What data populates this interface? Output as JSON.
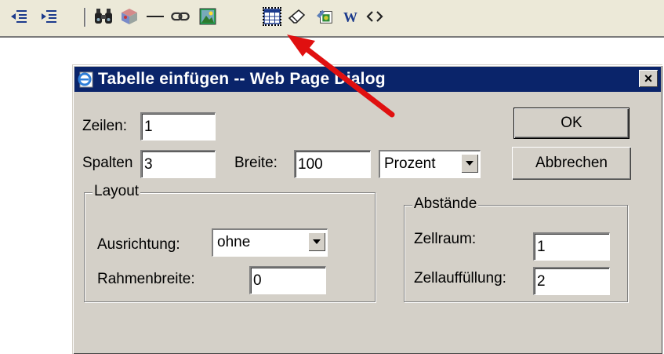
{
  "toolbar": {
    "icons": [
      "outdent-icon",
      "indent-icon",
      "find-icon",
      "object-icon",
      "horizontal-rule-icon",
      "link-icon",
      "image-icon",
      "insert-table-icon",
      "eraser-icon",
      "properties-icon",
      "word-icon",
      "code-icon"
    ]
  },
  "dialog": {
    "title": "Tabelle einfügen -- Web Page Dialog",
    "close_label": "×",
    "rows_label": "Zeilen:",
    "rows_value": "1",
    "cols_label": "Spalten",
    "cols_value": "3",
    "width_label": "Breite:",
    "width_value": "100",
    "width_unit": "Prozent",
    "ok_label": "OK",
    "cancel_label": "Abbrechen",
    "layout": {
      "title": "Layout",
      "align_label": "Ausrichtung:",
      "align_value": "ohne",
      "border_label": "Rahmenbreite:",
      "border_value": "0"
    },
    "spacing": {
      "title": "Abstände",
      "cellspacing_label": "Zellraum:",
      "cellspacing_value": "1",
      "cellpadding_label": "Zellauffüllung:",
      "cellpadding_value": "2"
    }
  },
  "colors": {
    "titlebar": "#0a246a",
    "dialog_bg": "#d4d0c8",
    "toolbar_bg": "#ece9d8",
    "annotation_arrow": "#e01010"
  }
}
